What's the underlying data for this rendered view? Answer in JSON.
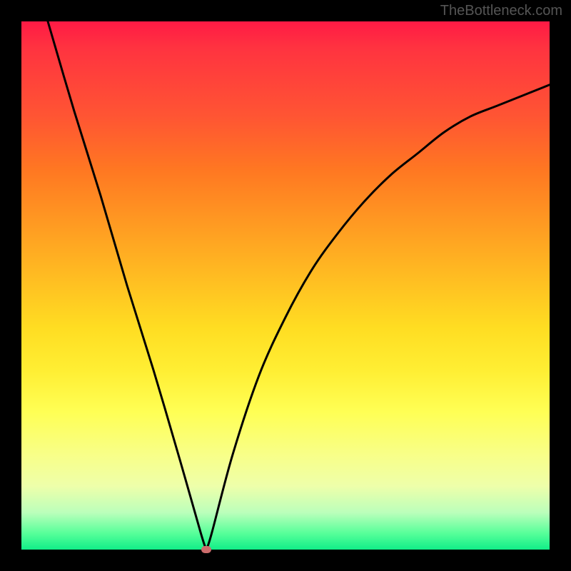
{
  "watermark": "TheBottleneck.com",
  "chart_data": {
    "type": "line",
    "title": "",
    "xlabel": "",
    "ylabel": "",
    "xlim": [
      0,
      100
    ],
    "ylim": [
      0,
      100
    ],
    "grid": false,
    "background_gradient": {
      "stops": [
        {
          "pos": 0,
          "color": "#ff1a45"
        },
        {
          "pos": 18,
          "color": "#ff5533"
        },
        {
          "pos": 38,
          "color": "#ff9922"
        },
        {
          "pos": 58,
          "color": "#ffdd22"
        },
        {
          "pos": 74,
          "color": "#ffff55"
        },
        {
          "pos": 93,
          "color": "#bbffbb"
        },
        {
          "pos": 100,
          "color": "#11ee88"
        }
      ]
    },
    "series": [
      {
        "name": "bottleneck-curve",
        "x": [
          5,
          10,
          15,
          20,
          25,
          30,
          34,
          35,
          36,
          40,
          45,
          50,
          55,
          60,
          65,
          70,
          75,
          80,
          85,
          90,
          95,
          100
        ],
        "values": [
          100,
          83,
          67,
          50,
          34,
          17,
          3,
          0,
          3,
          18,
          33,
          44,
          53,
          60,
          66,
          71,
          75,
          79,
          82,
          84,
          86,
          88
        ]
      }
    ],
    "markers": [
      {
        "name": "optimal-point",
        "x": 35,
        "y": 0,
        "color": "#cc6b6b"
      }
    ],
    "optimal_x": 35
  }
}
